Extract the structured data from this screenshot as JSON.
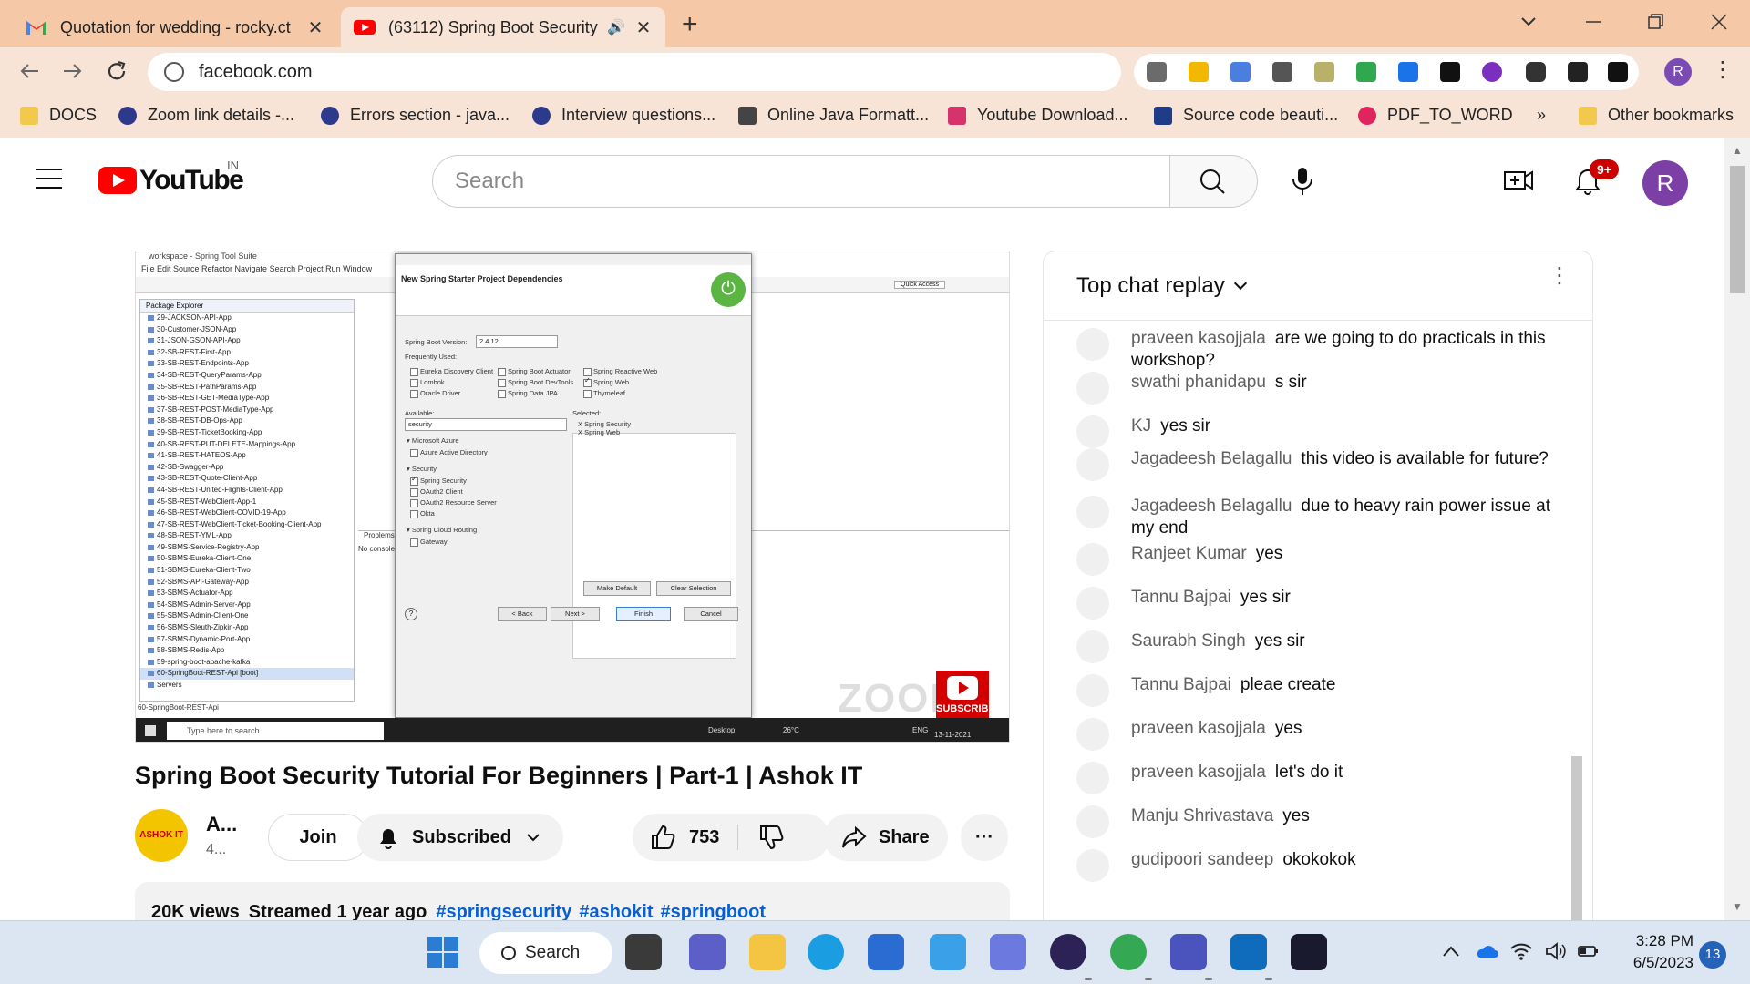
{
  "browser": {
    "tabs": [
      {
        "title": "Quotation for wedding - rocky.ct",
        "icon": "gmail-icon"
      },
      {
        "title": "(63112) Spring Boot Security",
        "icon": "youtube-icon",
        "audio": "🔊"
      }
    ],
    "close_glyph": "✕",
    "new_tab_glyph": "+",
    "url": "facebook.com",
    "bookmarks": [
      {
        "label": "DOCS",
        "color": "#f2c94c"
      },
      {
        "label": "Zoom link details -...",
        "color": "#2d3a8c"
      },
      {
        "label": "Errors section - java...",
        "color": "#2d3a8c"
      },
      {
        "label": "Interview questions...",
        "color": "#2d3a8c"
      },
      {
        "label": "Online Java Formatt...",
        "color": "#444444"
      },
      {
        "label": "Youtube Download...",
        "color": "#d6336c"
      },
      {
        "label": "Source code beauti...",
        "color": "#1f3c88"
      },
      {
        "label": "PDF_TO_WORD",
        "color": "#e0245e"
      }
    ],
    "bookmarks_overflow": "»",
    "other_bookmarks": "Other bookmarks",
    "profile_initial": "R"
  },
  "youtube": {
    "logo_text": "YouTube",
    "country": "IN",
    "search_placeholder": "Search",
    "notification_badge": "9+",
    "account_initial": "R"
  },
  "video_frame": {
    "ide_title": "workspace - Spring Tool Suite",
    "ide_menu": "File   Edit   Source   Refactor   Navigate   Search   Project   Run   Window",
    "quick_access": "Quick Access",
    "package_explorer": "Package Explorer",
    "projects": [
      "29-JACKSON-API-App",
      "30-Customer-JSON-App",
      "31-JSON-GSON-API-App",
      "32-SB-REST-First-App",
      "33-SB-REST-Endpoints-App",
      "34-SB-REST-QueryParams-App",
      "35-SB-REST-PathParams-App",
      "36-SB-REST-GET-MediaType-App",
      "37-SB-REST-POST-MediaType-App",
      "38-SB-REST-DB-Ops-App",
      "39-SB-REST-TicketBooking-App",
      "40-SB-REST-PUT-DELETE-Mappings-App",
      "41-SB-REST-HATEOS-App",
      "42-SB-Swagger-App",
      "43-SB-REST-Quote-Client-App",
      "44-SB-REST-United-Flights-Client-App",
      "45-SB-REST-WebClient-App-1",
      "46-SB-REST-WebClient-COVID-19-App",
      "47-SB-REST-WebClient-Ticket-Booking-Client-App",
      "48-SB-REST-YML-App",
      "49-SBMS-Service-Registry-App",
      "50-SBMS-Eureka-Client-One",
      "51-SBMS-Eureka-Client-Two",
      "52-SBMS-API-Gateway-App",
      "53-SBMS-Actuator-App",
      "54-SBMS-Admin-Server-App",
      "55-SBMS-Admin-Client-One",
      "56-SBMS-Sleuth-Zipkin-App",
      "57-SBMS-Dynamic-Port-App",
      "58-SBMS-Redis-App",
      "59-spring-boot-apache-kafka",
      "60-SpringBoot-REST-Api [boot]",
      "Servers"
    ],
    "status_bar": "60-SpringBoot-REST-Api",
    "problems_tab": "Problems",
    "no_consoles": "No consoles",
    "dialog": {
      "title": "New Spring Starter Project Dependencies",
      "boot_version_label": "Spring Boot Version:",
      "boot_version": "2.4.12",
      "frequently_used": "Frequently Used:",
      "frequent": [
        {
          "label": "Eureka Discovery Client",
          "checked": false
        },
        {
          "label": "Lombok",
          "checked": false
        },
        {
          "label": "Oracle Driver",
          "checked": false
        },
        {
          "label": "Spring Boot Actuator",
          "checked": false
        },
        {
          "label": "Spring Boot DevTools",
          "checked": false
        },
        {
          "label": "Spring Data JPA",
          "checked": false
        },
        {
          "label": "Spring Reactive Web",
          "checked": false
        },
        {
          "label": "Spring Web",
          "checked": true
        },
        {
          "label": "Thymeleaf",
          "checked": false
        }
      ],
      "available_label": "Available:",
      "available_filter": "security",
      "selected_label": "Selected:",
      "selected_items": [
        "X  Spring Security",
        "X  Spring Web"
      ],
      "groups": [
        {
          "name": "▾ Microsoft Azure",
          "items": [
            {
              "label": "Azure Active Directory",
              "checked": false
            }
          ]
        },
        {
          "name": "▾ Security",
          "items": [
            {
              "label": "Spring Security",
              "checked": true
            },
            {
              "label": "OAuth2 Client",
              "checked": false
            },
            {
              "label": "OAuth2 Resource Server",
              "checked": false
            },
            {
              "label": "Okta",
              "checked": false
            }
          ]
        },
        {
          "name": "▾ Spring Cloud Routing",
          "items": [
            {
              "label": "Gateway",
              "checked": false
            }
          ]
        }
      ],
      "make_default": "Make Default",
      "clear_selection": "Clear Selection",
      "back": "< Back",
      "next": "Next >",
      "finish": "Finish",
      "cancel": "Cancel",
      "help": "?"
    },
    "watermark": "ZOOM",
    "subscribe": "SUBSCRIBE",
    "taskbar_search": "Type here to search",
    "desktop": "Desktop",
    "weather": "26°C",
    "lang": "ENG",
    "date": "13-11-2021"
  },
  "video": {
    "title": "Spring Boot Security Tutorial For Beginners | Part-1 | Ashok IT",
    "channel_name": "A...",
    "channel_subs": "4...",
    "channel_avatar_text": "ASHOK IT",
    "join_label": "Join",
    "subscribed_label": "Subscribed",
    "likes": "753",
    "share_label": "Share",
    "more_glyph": "···",
    "views": "20K views",
    "streamed": "Streamed 1 year ago",
    "hashtags": [
      "#springsecurity",
      "#ashokit",
      "#springboot"
    ]
  },
  "chat": {
    "title": "Top chat replay",
    "kebab": "⋮",
    "messages": [
      {
        "author": "praveen kasojjala",
        "text": "are we going to do practicals in this workshop?"
      },
      {
        "author": "swathi phanidapu",
        "text": "s sir"
      },
      {
        "author": "KJ",
        "text": "yes sir"
      },
      {
        "author": "Jagadeesh Belagallu",
        "text": "this video is available for future?"
      },
      {
        "author": "Jagadeesh Belagallu",
        "text": "due to heavy rain power issue at my end"
      },
      {
        "author": "Ranjeet Kumar",
        "text": "yes"
      },
      {
        "author": "Tannu Bajpai",
        "text": "yes sir"
      },
      {
        "author": "Saurabh Singh",
        "text": "yes sir"
      },
      {
        "author": "Tannu Bajpai",
        "text": "pleae create"
      },
      {
        "author": "praveen kasojjala",
        "text": "yes"
      },
      {
        "author": "praveen kasojjala",
        "text": "let's do it"
      },
      {
        "author": "Manju Shrivastava",
        "text": "yes"
      },
      {
        "author": "gudipoori sandeep",
        "text": "okokokok"
      }
    ]
  },
  "taskbar": {
    "search_label": "Search",
    "time": "3:28 PM",
    "date": "6/5/2023",
    "notification_count": "13",
    "apps": [
      {
        "name": "start-icon",
        "color": "#2b7cd3"
      },
      {
        "name": "task-view-icon",
        "color": "#3a3a3a"
      },
      {
        "name": "chat-icon",
        "color": "#5b5fc7"
      },
      {
        "name": "file-explorer-icon",
        "color": "#f4c542"
      },
      {
        "name": "edge-icon",
        "color": "#1b9de2"
      },
      {
        "name": "store-icon",
        "color": "#2b6cd3"
      },
      {
        "name": "photos-icon",
        "color": "#3aa0e8"
      },
      {
        "name": "snipping-tool-icon",
        "color": "#6c7ae0"
      },
      {
        "name": "eclipse-icon",
        "color": "#2c2255"
      },
      {
        "name": "chrome-icon",
        "color": "#34a853"
      },
      {
        "name": "teams-icon",
        "color": "#4b53bc"
      },
      {
        "name": "outlook-icon",
        "color": "#0f6cbd"
      },
      {
        "name": "zoom-icon",
        "color": "#1a1a2e"
      }
    ]
  }
}
